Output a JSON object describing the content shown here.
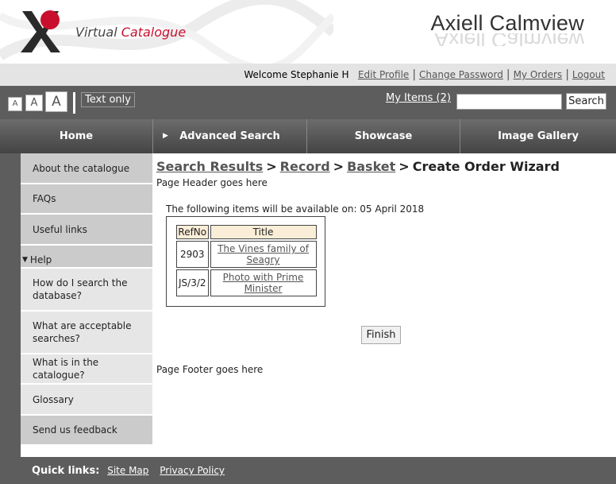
{
  "header": {
    "logo_word1": "Virtual",
    "logo_word2": "Catalogue",
    "brand": "Axiell Calmview"
  },
  "user_bar": {
    "welcome": "Welcome Stephanie H",
    "links": [
      "Edit Profile",
      "Change Password",
      "My Orders",
      "Logout"
    ]
  },
  "toolbar": {
    "font_small": "A",
    "font_medium": "A",
    "font_large": "A",
    "text_only": "Text only",
    "my_items": "My Items (2)",
    "search_value": "",
    "search_button": "Search"
  },
  "nav": {
    "items": [
      "Home",
      "Advanced Search",
      "Showcase",
      "Image Gallery"
    ]
  },
  "sidebar": {
    "items": [
      {
        "label": "About the catalogue"
      },
      {
        "label": "FAQs"
      },
      {
        "label": "Useful links"
      },
      {
        "label": "Help"
      },
      {
        "label": "How do I search the database?"
      },
      {
        "label": "What are acceptable searches?"
      },
      {
        "label": "What is in the catalogue?"
      },
      {
        "label": "Glossary"
      },
      {
        "label": "Send us feedback"
      }
    ]
  },
  "breadcrumb": {
    "items": [
      "Search Results",
      "Record",
      "Basket"
    ],
    "current": "Create Order Wizard",
    "separator": ">"
  },
  "content": {
    "page_header": "Page Header goes here",
    "availability": "The following items will be available on: 05 April 2018",
    "table": {
      "headers": [
        "RefNo",
        "Title"
      ],
      "rows": [
        {
          "ref": "2903",
          "title": "The Vines family of Seagry"
        },
        {
          "ref": "JS/3/2",
          "title": "Photo with Prime Minister"
        }
      ]
    },
    "finish_button": "Finish",
    "page_footer": "Page Footer goes here"
  },
  "footer": {
    "quick_links_label": "Quick links:",
    "links": [
      "Site Map",
      "Privacy Policy"
    ]
  },
  "colors": {
    "accent_red": "#c8102e",
    "dark_gray": "#5d5d5d",
    "table_header_bg": "#fbeed8"
  }
}
